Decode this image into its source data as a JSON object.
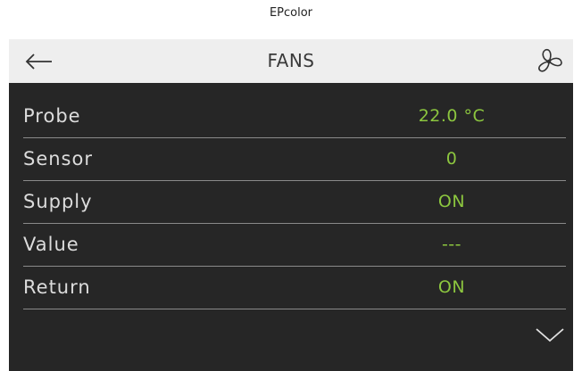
{
  "app": {
    "title": "EPcolor"
  },
  "header": {
    "title": "FANS"
  },
  "rows": [
    {
      "label": "Probe",
      "value": "22.0 °C"
    },
    {
      "label": "Sensor",
      "value": "0"
    },
    {
      "label": "Supply",
      "value": "ON"
    },
    {
      "label": "Value",
      "value": "---"
    },
    {
      "label": "Return",
      "value": "ON"
    }
  ],
  "icons": {
    "back": "arrow-left-icon",
    "menu": "fan-icon",
    "scroll": "chevron-down-icon"
  },
  "colors": {
    "header_bg": "#eeeeee",
    "content_bg": "#262626",
    "value_green": "#8cc63f",
    "label": "#dcdcdc"
  }
}
